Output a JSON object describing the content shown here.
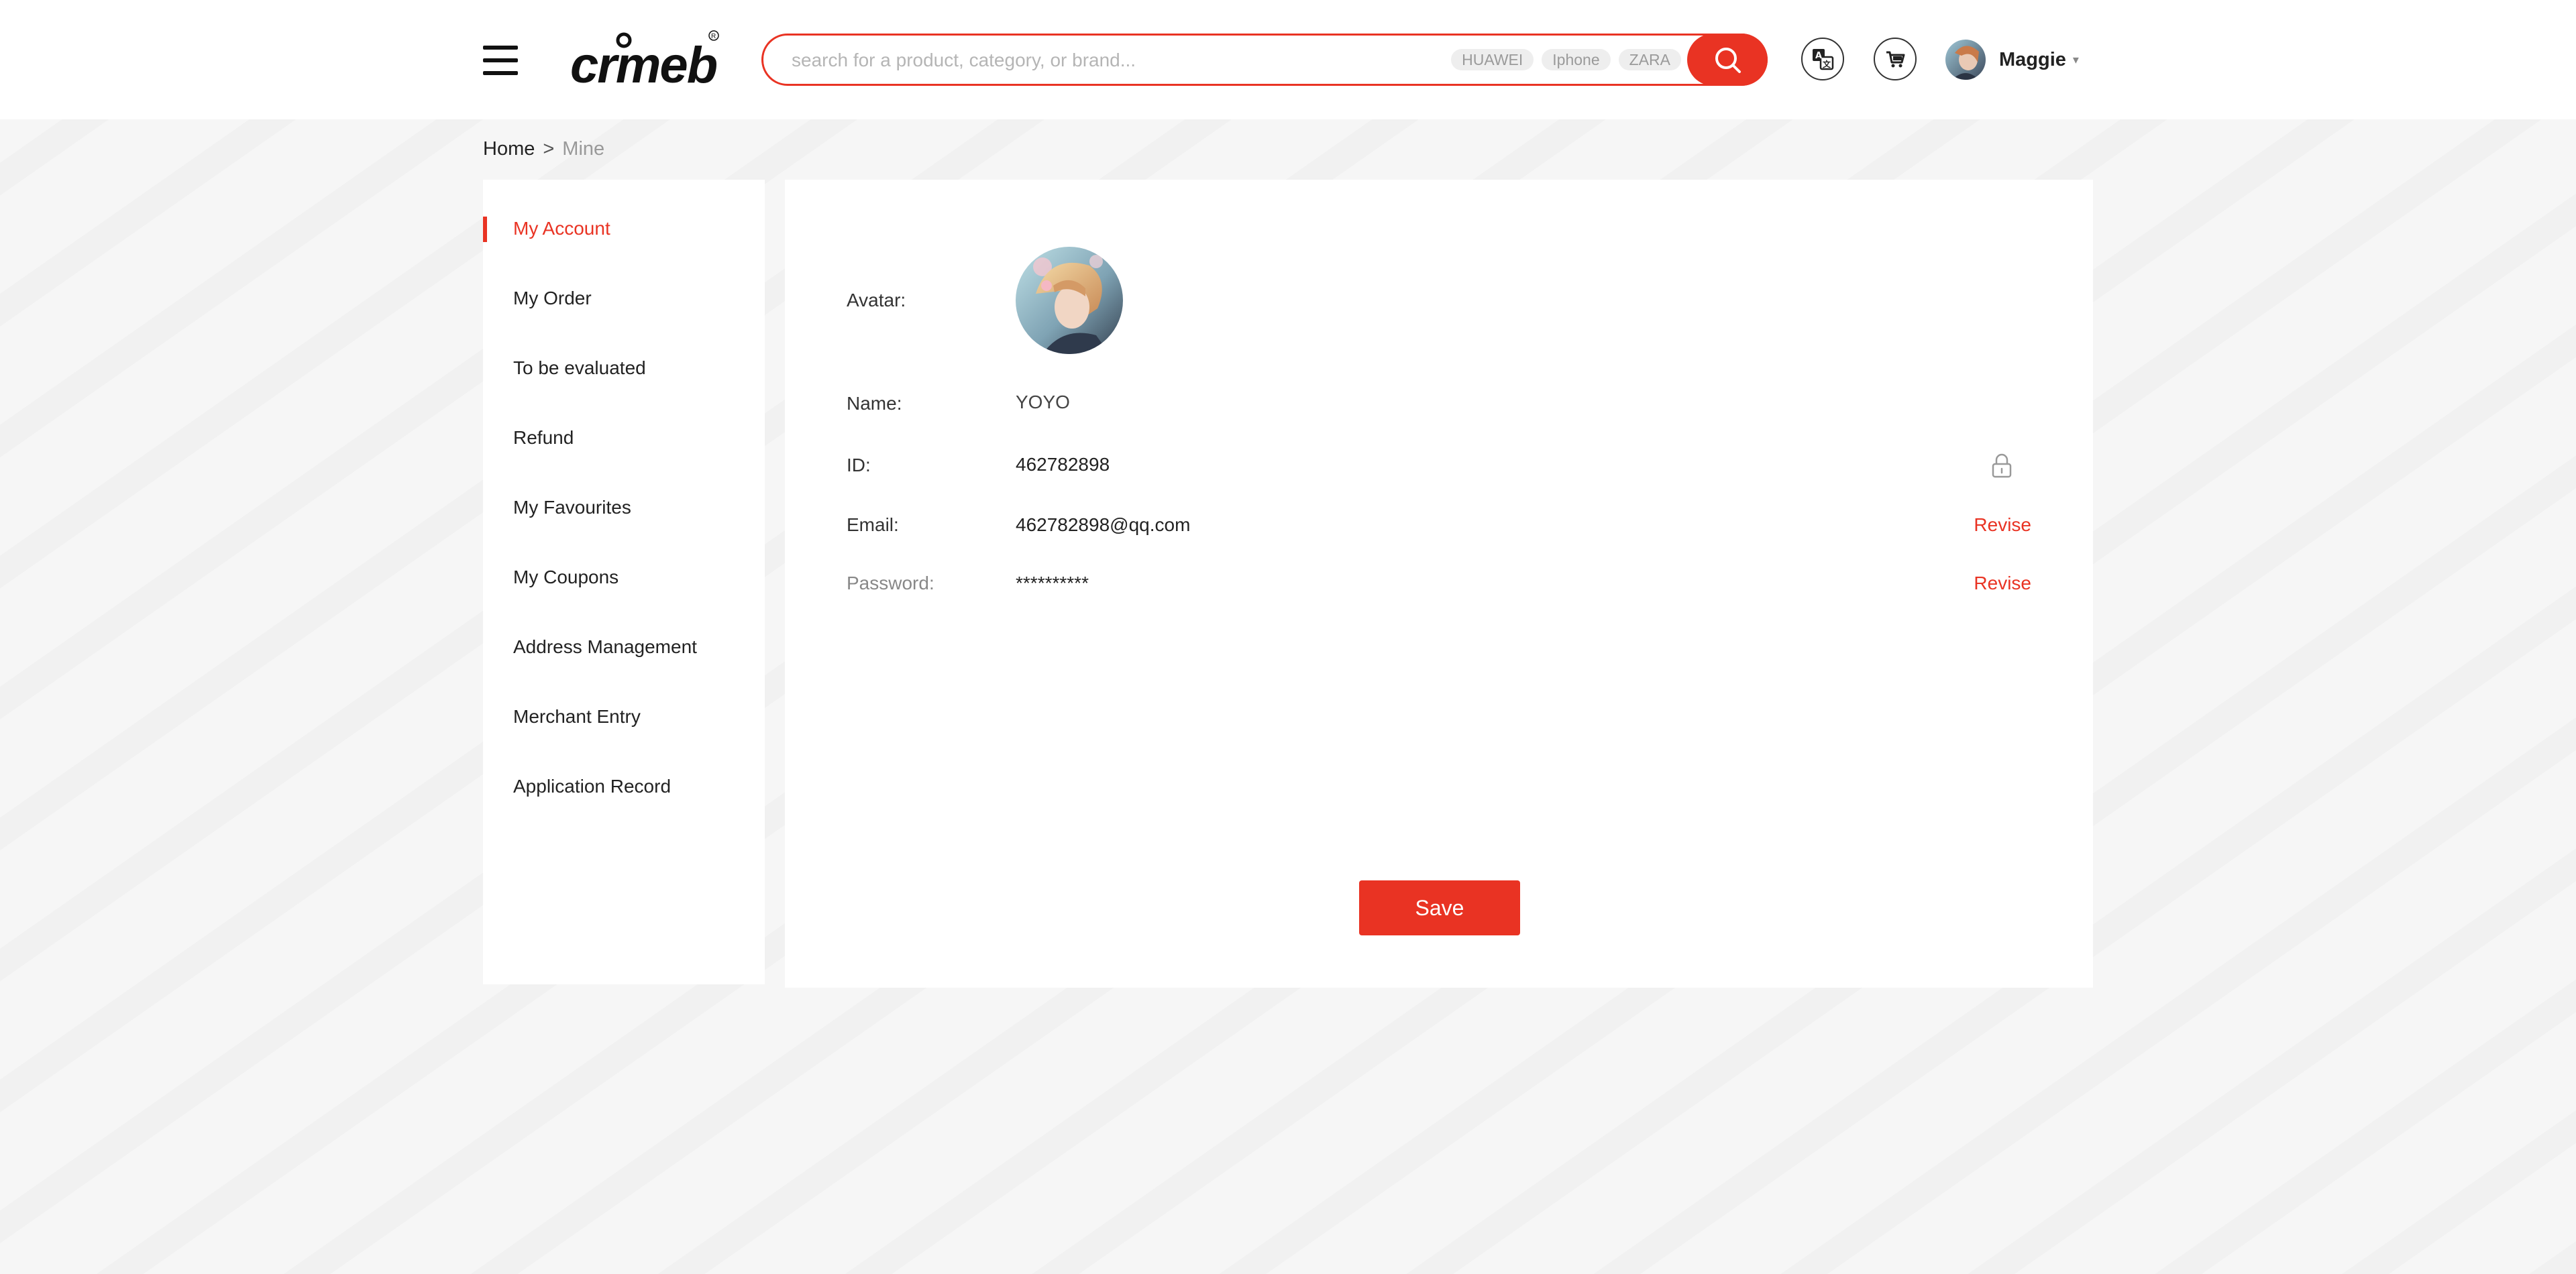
{
  "header": {
    "logo_text": "crmeb",
    "search": {
      "placeholder": "search for a product, category, or brand...",
      "value": "",
      "hot_tags": [
        "HUAWEI",
        "Iphone",
        "ZARA"
      ]
    },
    "user": {
      "name": "Maggie"
    }
  },
  "breadcrumb": {
    "home": "Home",
    "separator": ">",
    "current": "Mine"
  },
  "sidebar": {
    "items": [
      {
        "label": "My Account",
        "active": true
      },
      {
        "label": "My Order",
        "active": false
      },
      {
        "label": "To be evaluated",
        "active": false
      },
      {
        "label": "Refund",
        "active": false
      },
      {
        "label": "My Favourites",
        "active": false
      },
      {
        "label": "My Coupons",
        "active": false
      },
      {
        "label": "Address Management",
        "active": false
      },
      {
        "label": "Merchant Entry",
        "active": false
      },
      {
        "label": "Application Record",
        "active": false
      }
    ]
  },
  "account": {
    "avatar_label": "Avatar:",
    "name_label": "Name:",
    "name_value": "YOYO",
    "id_label": "ID:",
    "id_value": "462782898",
    "email_label": "Email:",
    "email_value": "462782898@qq.com",
    "email_action": "Revise",
    "password_label": "Password:",
    "password_value": "**********",
    "password_action": "Revise",
    "save_label": "Save"
  },
  "colors": {
    "accent": "#e93323",
    "background": "#f6f6f6"
  }
}
